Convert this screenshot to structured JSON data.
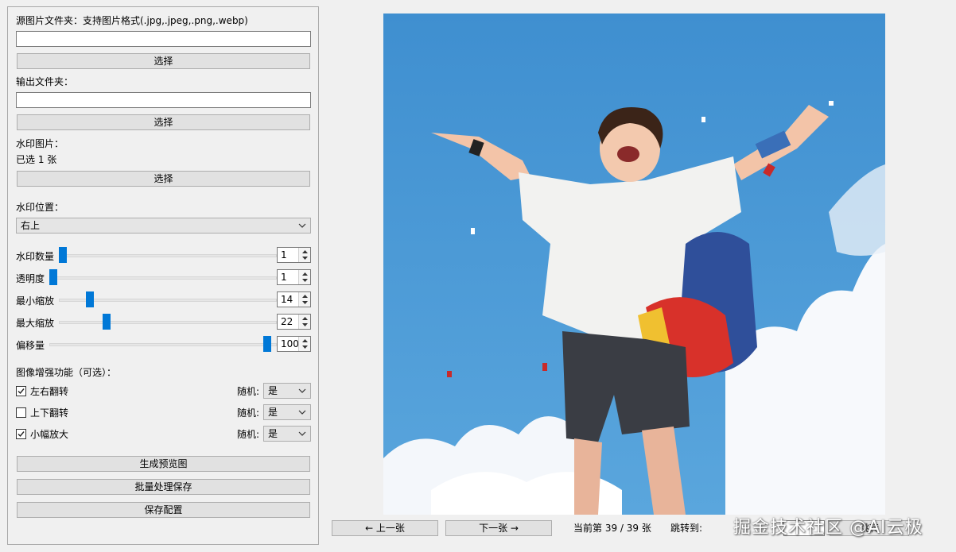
{
  "left_panel": {
    "source_label": "源图片文件夹：支持图片格式(.jpg,.jpeg,.png,.webp)",
    "source_value": "",
    "source_button": "选择",
    "output_label": "输出文件夹：",
    "output_value": "",
    "output_button": "选择",
    "watermark_label": "水印图片：",
    "watermark_selected": "已选 1 张",
    "watermark_button": "选择",
    "position_label": "水印位置：",
    "position_value": "右上",
    "sliders": [
      {
        "label": "水印数量",
        "value": "1",
        "level": 0.0
      },
      {
        "label": "透明度",
        "value": "1",
        "level": 0.0
      },
      {
        "label": "最小缩放",
        "value": "14",
        "level": 0.14
      },
      {
        "label": "最大缩放",
        "value": "22",
        "level": 0.22
      },
      {
        "label": "偏移量",
        "value": "100",
        "level": 1.0
      }
    ],
    "enhance_label": "图像增强功能（可选）：",
    "enhancements": [
      {
        "label": "左右翻转",
        "checked": true,
        "random_label": "随机:",
        "random_value": "是"
      },
      {
        "label": "上下翻转",
        "checked": false,
        "random_label": "随机:",
        "random_value": "是"
      },
      {
        "label": "小幅放大",
        "checked": true,
        "random_label": "随机:",
        "random_value": "是"
      }
    ],
    "generate_preview_button": "生成预览图",
    "batch_button": "批量处理保存",
    "save_config_button": "保存配置"
  },
  "preview": {
    "prev_button": "← 上一张",
    "next_button": "下一张 →",
    "counter": "当前第 39 / 39 张",
    "jump_label": "跳转到:",
    "jump_button": "跳转",
    "overlay_watermark": "掘金技术社区 @AI云极"
  },
  "colors": {
    "accent": "#0078d7",
    "sky": "#3a8fd0",
    "background": "#f0f0f0"
  }
}
